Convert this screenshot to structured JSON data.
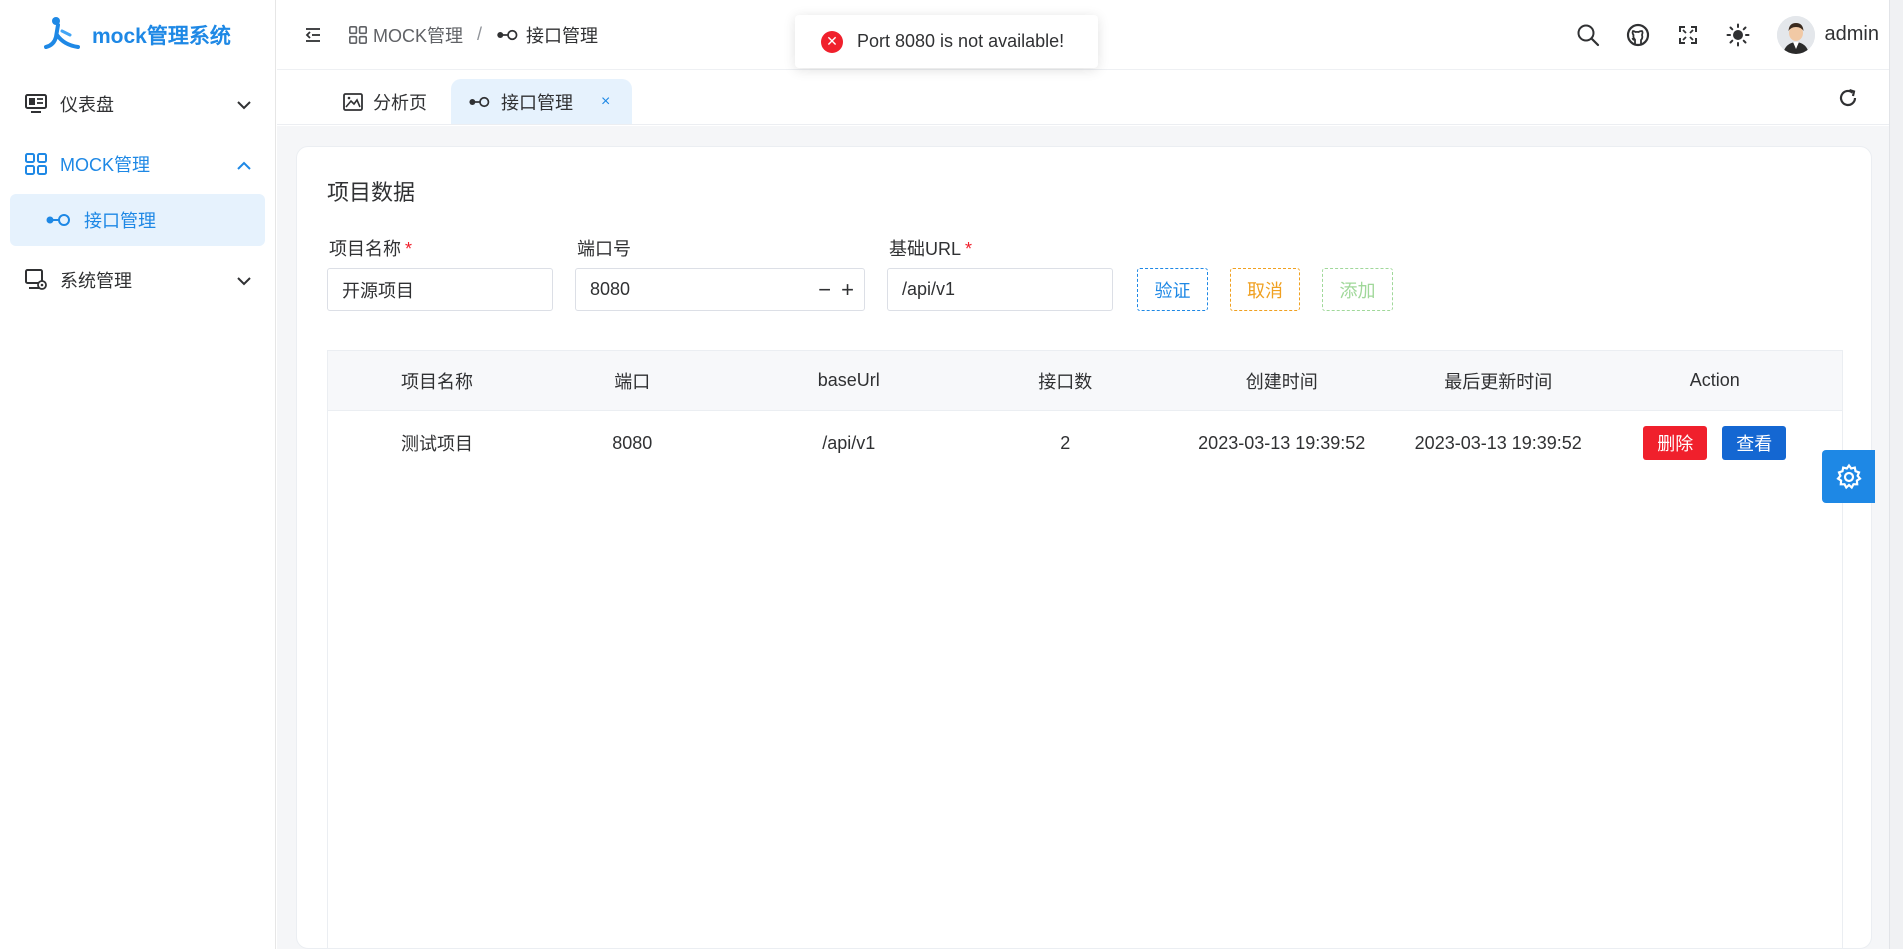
{
  "app": {
    "title": "mock管理系统"
  },
  "sidebar": {
    "items": [
      {
        "label": "仪表盘",
        "icon": "monitor-icon"
      },
      {
        "label": "MOCK管理",
        "icon": "grid-icon"
      },
      {
        "label": "系统管理",
        "icon": "system-icon"
      }
    ],
    "submenu": {
      "label": "接口管理",
      "icon": "interface-icon"
    }
  },
  "breadcrumb": {
    "parent": "MOCK管理",
    "current": "接口管理",
    "separator": "/"
  },
  "header": {
    "username": "admin"
  },
  "toast": {
    "message": "Port 8080 is not available!"
  },
  "tabs": [
    {
      "label": "分析页"
    },
    {
      "label": "接口管理",
      "close": "×"
    }
  ],
  "card": {
    "title": "项目数据"
  },
  "form": {
    "project_name": {
      "label": "项目名称",
      "required": "*",
      "value": "开源项目"
    },
    "port": {
      "label": "端口号",
      "value": "8080",
      "minus": "−",
      "plus": "+"
    },
    "base_url": {
      "label": "基础URL",
      "required": "*",
      "value": "/api/v1"
    },
    "buttons": {
      "verify": "验证",
      "cancel": "取消",
      "add": "添加"
    }
  },
  "table": {
    "headers": [
      "项目名称",
      "端口",
      "baseUrl",
      "接口数",
      "创建时间",
      "最后更新时间",
      "Action"
    ],
    "rows": [
      {
        "name": "测试项目",
        "port": "8080",
        "baseUrl": "/api/v1",
        "count": "2",
        "created": "2023-03-13 19:39:52",
        "updated": "2023-03-13 19:39:52"
      }
    ],
    "actions": {
      "delete": "删除",
      "view": "查看"
    }
  },
  "colors": {
    "primary": "#1e88e5",
    "danger": "#f0202c",
    "warning": "#f0a020",
    "success_light": "#a0d89a",
    "view_button": "#1467d2"
  }
}
